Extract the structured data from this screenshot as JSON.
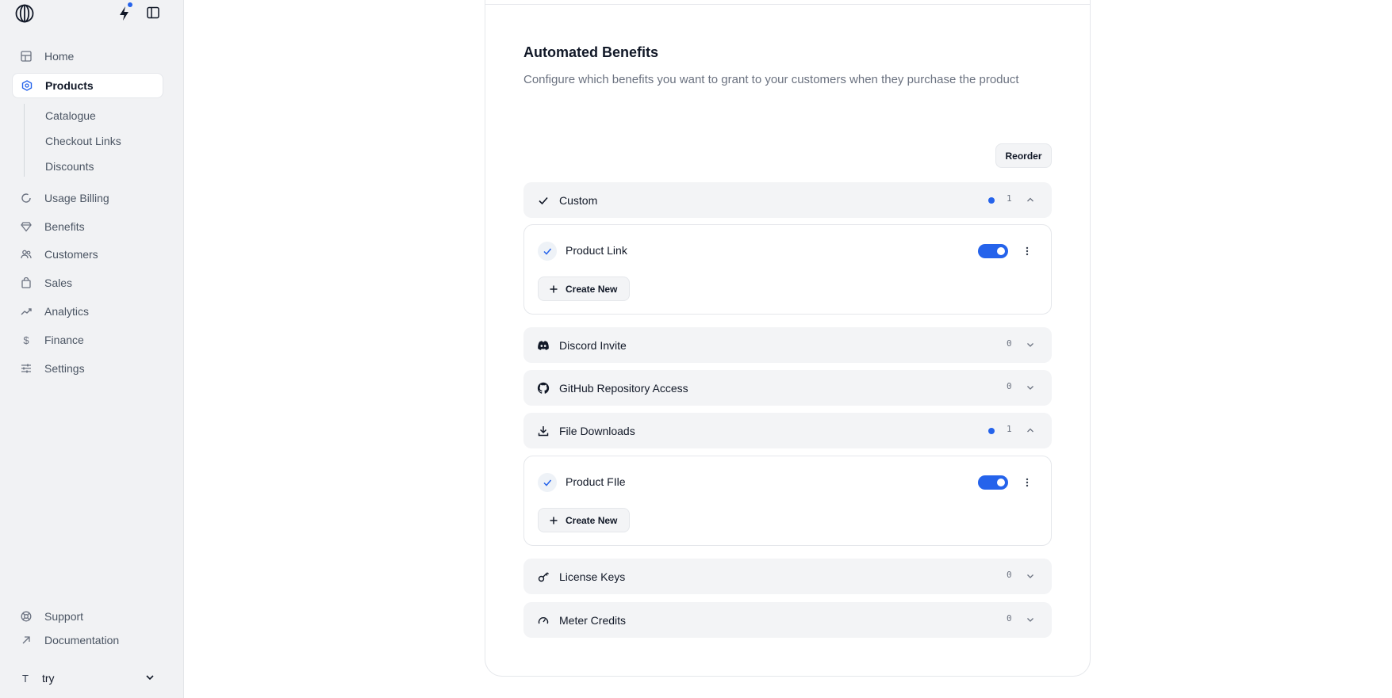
{
  "sidebar": {
    "nav": {
      "home": "Home",
      "products": "Products",
      "usage_billing": "Usage Billing",
      "benefits": "Benefits",
      "customers": "Customers",
      "sales": "Sales",
      "analytics": "Analytics",
      "finance": "Finance",
      "settings": "Settings"
    },
    "products_sub": {
      "catalogue": "Catalogue",
      "checkout_links": "Checkout Links",
      "discounts": "Discounts"
    },
    "footer": {
      "support": "Support",
      "documentation": "Documentation"
    },
    "org": {
      "initial": "T",
      "name": "try"
    }
  },
  "benefits_section": {
    "title": "Automated Benefits",
    "description": "Configure which benefits you want to grant to your customers when they purchase the product",
    "reorder_label": "Reorder",
    "create_new_label": "Create New",
    "groups": [
      {
        "label": "Custom",
        "count": "1",
        "expanded": true,
        "icon": "check-icon"
      },
      {
        "label": "Discord Invite",
        "count": "0",
        "expanded": false,
        "icon": "discord-icon"
      },
      {
        "label": "GitHub Repository Access",
        "count": "0",
        "expanded": false,
        "icon": "github-icon"
      },
      {
        "label": "File Downloads",
        "count": "1",
        "expanded": true,
        "icon": "download-icon"
      },
      {
        "label": "License Keys",
        "count": "0",
        "expanded": false,
        "icon": "key-icon"
      },
      {
        "label": "Meter Credits",
        "count": "0",
        "expanded": false,
        "icon": "gauge-icon"
      }
    ],
    "items": {
      "custom": {
        "label": "Product Link",
        "enabled": true
      },
      "file_downloads": {
        "label": "Product FIle",
        "enabled": true
      }
    }
  },
  "colors": {
    "accent": "#2563eb",
    "sidebar_bg": "#f1f2f4",
    "group_bg": "#f3f4f6"
  }
}
